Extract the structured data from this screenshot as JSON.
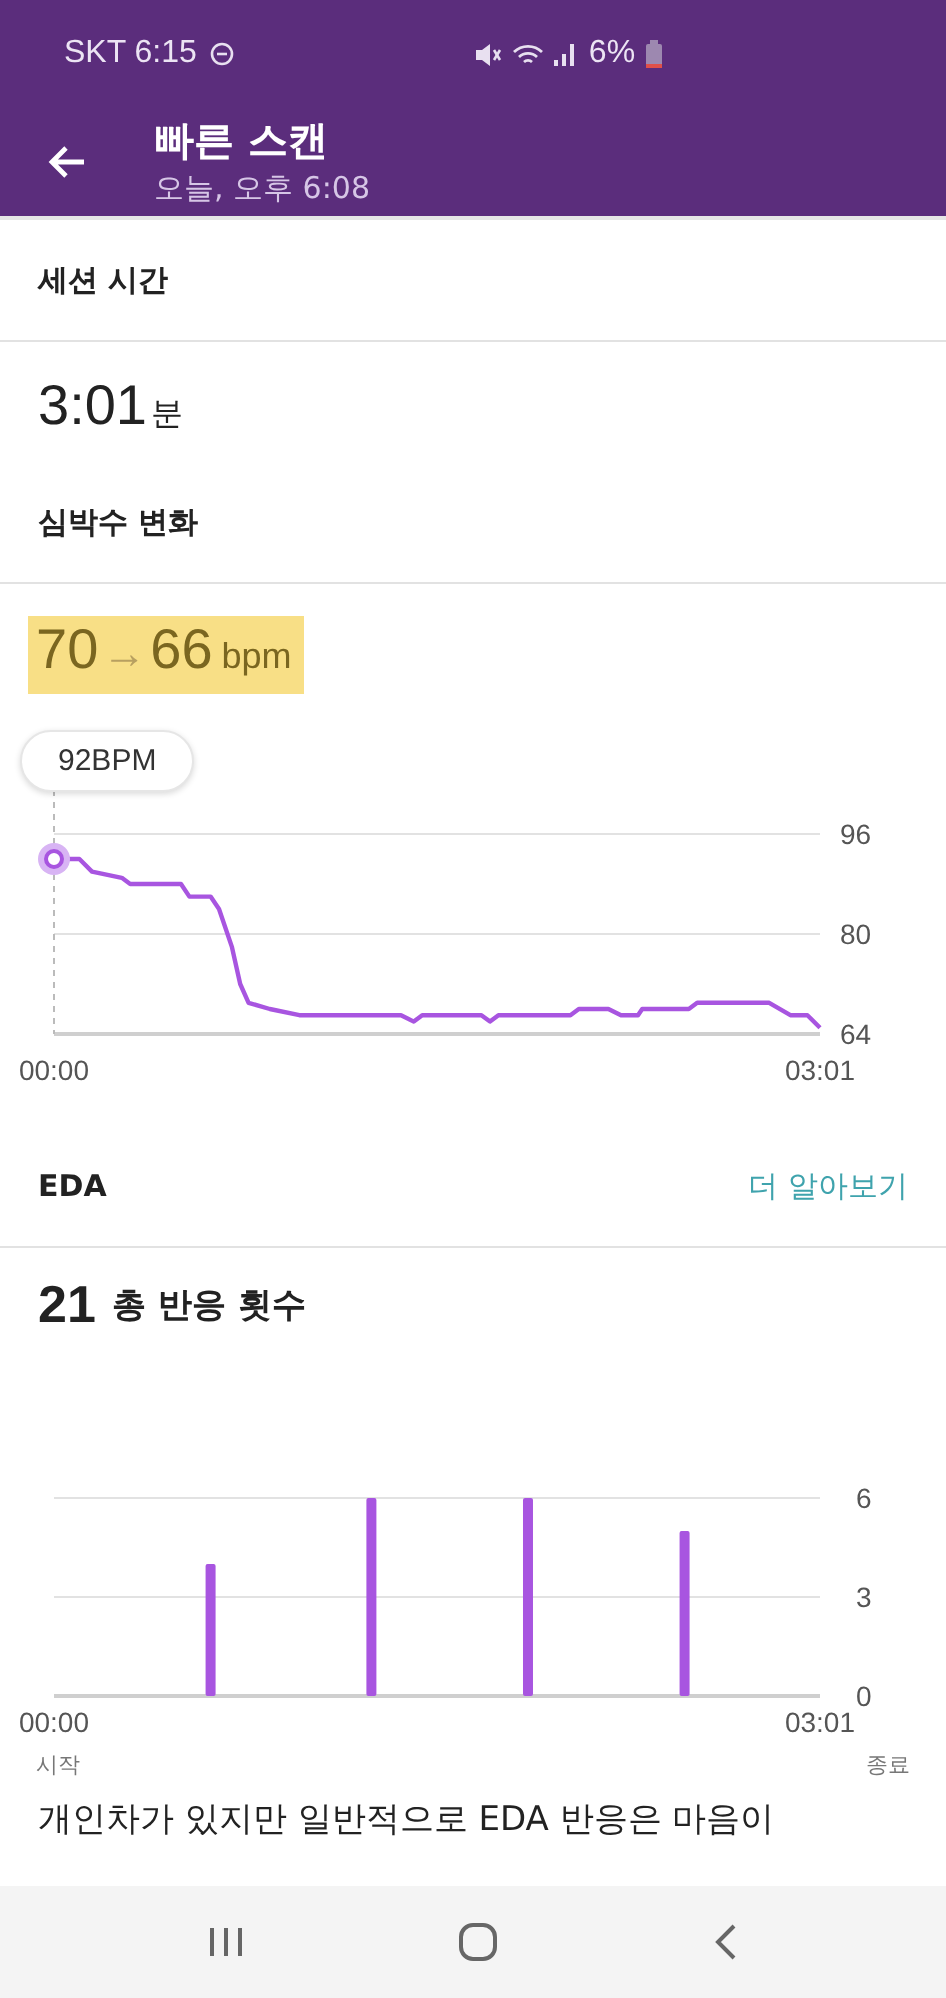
{
  "status_bar": {
    "carrier_time": "SKT 6:15",
    "battery": "6%"
  },
  "app_bar": {
    "title": "빠른 스캔",
    "subtitle": "오늘, 오후 6:08"
  },
  "session": {
    "heading": "세션 시간",
    "value": "3:01",
    "unit": "분"
  },
  "heart_rate": {
    "heading": "심박수 변화",
    "from": "70",
    "arrow": "→",
    "to": "66",
    "unit": "bpm",
    "tooltip": "92BPM",
    "chart_data": {
      "type": "line",
      "x": [
        0,
        6,
        9,
        16,
        18,
        30,
        32,
        37,
        39,
        42,
        44,
        46,
        51,
        58,
        82,
        85,
        87,
        101,
        103,
        105,
        122,
        124,
        131,
        134,
        138,
        139,
        150,
        152,
        169,
        174,
        178,
        181
      ],
      "xlim": [
        0,
        181
      ],
      "ylim": [
        64,
        96
      ],
      "yticks": [
        64,
        80,
        96
      ],
      "xticks": [
        {
          "value": 0,
          "label": "00:00"
        },
        {
          "value": 181,
          "label": "03:01"
        }
      ],
      "series": [
        {
          "color": "#a855e0",
          "values": [
            92,
            92,
            90,
            89,
            88,
            88,
            86,
            86,
            84,
            78,
            72,
            69,
            68,
            67,
            67,
            66,
            67,
            67,
            66,
            67,
            67,
            68,
            68,
            67,
            67,
            68,
            68,
            69,
            69,
            67,
            67,
            65
          ]
        }
      ]
    }
  },
  "eda": {
    "heading": "EDA",
    "link": "더 알아보기",
    "count": "21",
    "count_label": "총 반응 횟수",
    "chart_data": {
      "type": "bar",
      "x": [
        37,
        75,
        112,
        149
      ],
      "xlim": [
        0,
        181
      ],
      "ylim": [
        0,
        6
      ],
      "yticks": [
        0,
        3,
        6
      ],
      "xticks": [
        {
          "value": 0,
          "label": "00:00"
        },
        {
          "value": 181,
          "label": "03:01"
        }
      ],
      "series": [
        {
          "color": "#a855e0",
          "values": [
            4,
            6,
            6,
            5
          ]
        }
      ]
    },
    "start_label": "시작",
    "end_label": "종료",
    "description": "개인차가 있지만 일반적으로 EDA 반응은 마음이"
  }
}
